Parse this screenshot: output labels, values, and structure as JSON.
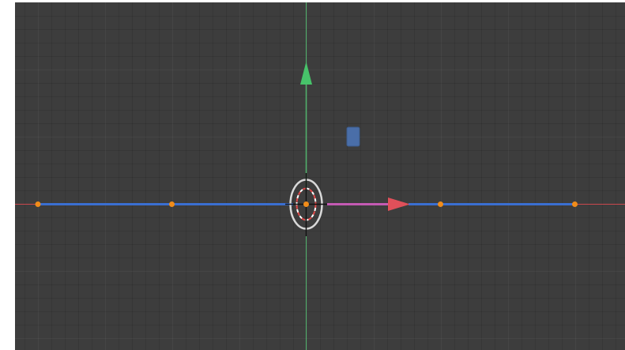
{
  "viewport": {
    "background": "#3d3d3d",
    "x_axis_color": "#c9484d",
    "y_axis_color": "#4fb26b",
    "curve_color": "#3a6fd1",
    "vertex_color": "#f08c1a",
    "selected_handle_color": "#4a6ea8"
  },
  "gizmo": {
    "x_arrow_color": "#e0505a",
    "y_arrow_color": "#47c36a",
    "pivot_ring_color": "#d8d8d8",
    "pivot_dash_color": "#e04848"
  },
  "icons": {
    "origin": "origin-icon",
    "cursor": "3d-cursor-icon"
  }
}
